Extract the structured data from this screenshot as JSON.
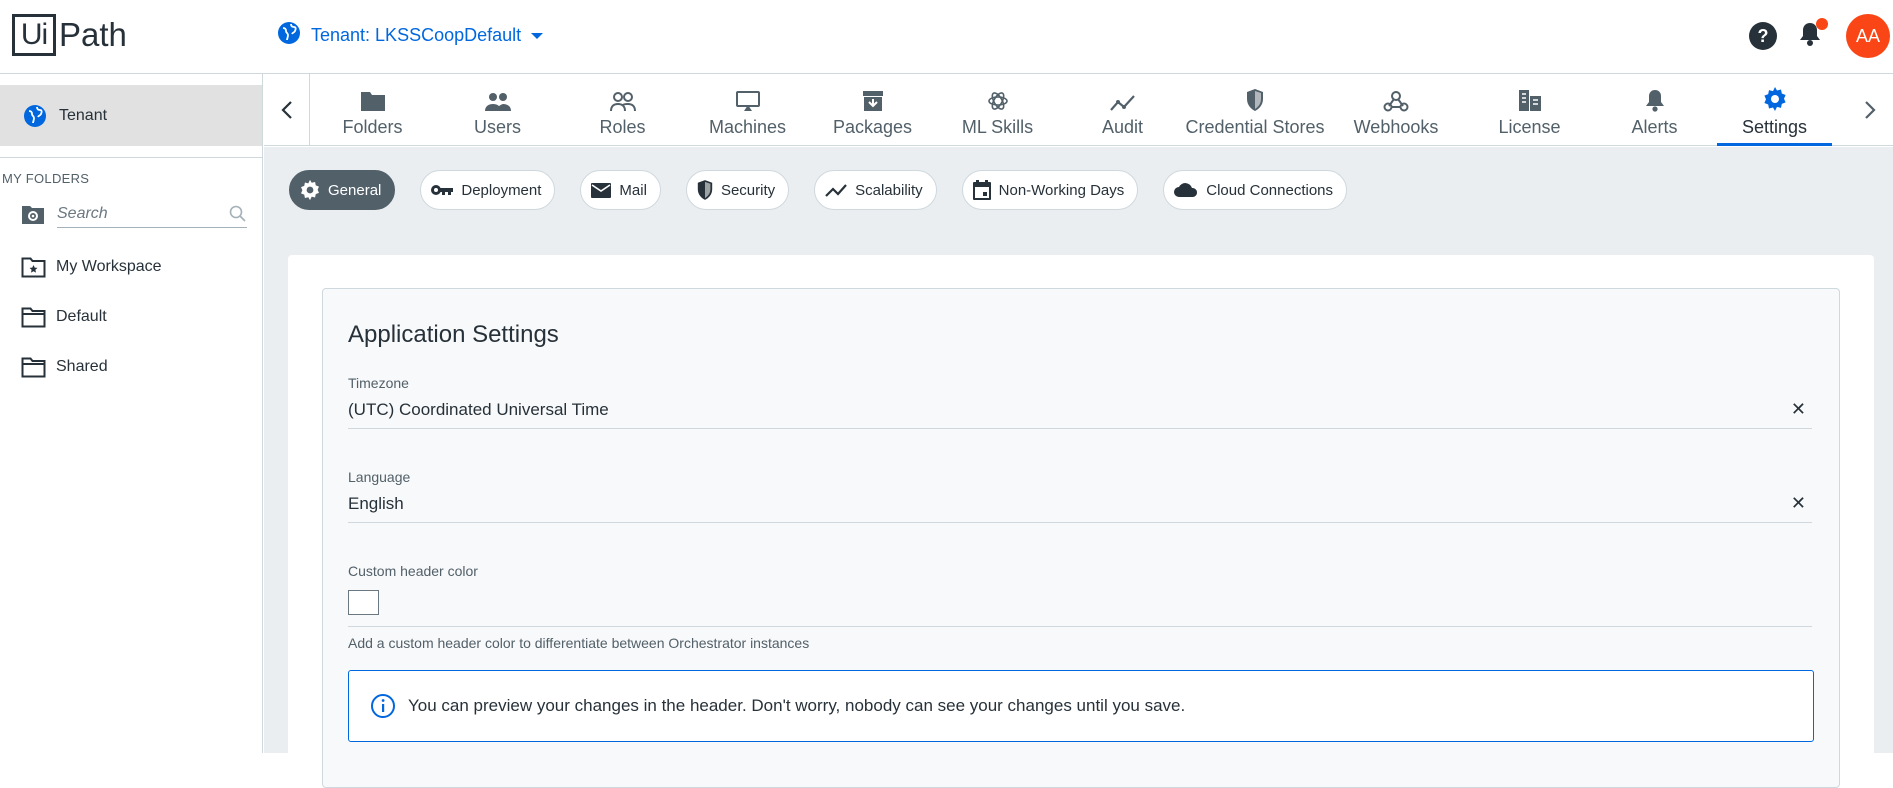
{
  "header": {
    "logo_box": "Ui",
    "logo_text": "Path",
    "tenant_label": "Tenant: LKSSCoopDefault",
    "help_glyph": "?",
    "avatar_initials": "AA",
    "brand_color": "#fa4616",
    "accent_color": "#0067df"
  },
  "sidebar": {
    "tenant_label": "Tenant",
    "folders_heading": "MY FOLDERS",
    "search_placeholder": "Search",
    "folders": [
      {
        "label": "My Workspace",
        "icon": "workspace-folder-icon"
      },
      {
        "label": "Default",
        "icon": "folder-icon"
      },
      {
        "label": "Shared",
        "icon": "folder-icon"
      }
    ]
  },
  "nav": {
    "tabs": [
      {
        "label": "Folders",
        "icon": "folder-icon"
      },
      {
        "label": "Users",
        "icon": "users-icon"
      },
      {
        "label": "Roles",
        "icon": "roles-icon"
      },
      {
        "label": "Machines",
        "icon": "machine-icon"
      },
      {
        "label": "Packages",
        "icon": "package-icon"
      },
      {
        "label": "ML Skills",
        "icon": "ml-skills-icon"
      },
      {
        "label": "Audit",
        "icon": "audit-icon"
      },
      {
        "label": "Credential Stores",
        "icon": "shield-icon"
      },
      {
        "label": "Webhooks",
        "icon": "webhook-icon"
      },
      {
        "label": "License",
        "icon": "license-icon"
      },
      {
        "label": "Alerts",
        "icon": "bell-icon"
      },
      {
        "label": "Settings",
        "icon": "gear-icon",
        "active": true
      }
    ]
  },
  "settings_tabs": [
    {
      "label": "General",
      "icon": "gear-icon",
      "active": true
    },
    {
      "label": "Deployment",
      "icon": "key-icon"
    },
    {
      "label": "Mail",
      "icon": "mail-icon"
    },
    {
      "label": "Security",
      "icon": "shield-icon"
    },
    {
      "label": "Scalability",
      "icon": "trend-icon"
    },
    {
      "label": "Non-Working Days",
      "icon": "calendar-icon"
    },
    {
      "label": "Cloud Connections",
      "icon": "cloud-icon"
    }
  ],
  "app_settings": {
    "title": "Application Settings",
    "timezone_label": "Timezone",
    "timezone_value": "(UTC) Coordinated Universal Time",
    "language_label": "Language",
    "language_value": "English",
    "header_color_label": "Custom header color",
    "header_color_value": "#ffffff",
    "header_color_helper": "Add a custom header color to differentiate between Orchestrator instances",
    "clear_glyph": "✕",
    "info_message": "You can preview your changes in the header. Don't worry, nobody can see your changes until you save."
  }
}
